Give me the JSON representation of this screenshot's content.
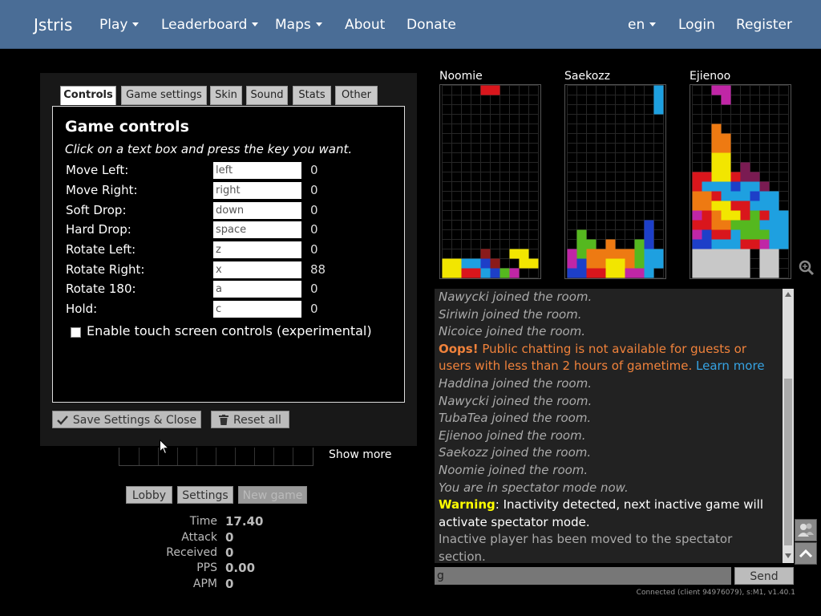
{
  "navbar": {
    "brand": "Jstris",
    "menu": [
      {
        "label": "Play",
        "dropdown": true
      },
      {
        "label": "Leaderboard",
        "dropdown": true
      },
      {
        "label": "Maps",
        "dropdown": true
      },
      {
        "label": "About",
        "dropdown": false
      },
      {
        "label": "Donate",
        "dropdown": false
      }
    ],
    "right": [
      {
        "label": "en",
        "dropdown": true
      },
      {
        "label": "Login",
        "dropdown": false
      },
      {
        "label": "Register",
        "dropdown": false
      }
    ],
    "color": "#4a6d96"
  },
  "settings": {
    "tabs": [
      "Controls",
      "Game settings",
      "Skin",
      "Sound",
      "Stats",
      "Other"
    ],
    "active_tab": "Controls",
    "title": "Game controls",
    "hint": "Click on a text box and press the key you want.",
    "controls": [
      {
        "label": "Move Left:",
        "key": "left",
        "value": "0"
      },
      {
        "label": "Move Right:",
        "key": "right",
        "value": "0"
      },
      {
        "label": "Soft Drop:",
        "key": "down",
        "value": "0"
      },
      {
        "label": "Hard Drop:",
        "key": "space",
        "value": "0"
      },
      {
        "label": "Rotate Left:",
        "key": "z",
        "value": "0"
      },
      {
        "label": "Rotate Right:",
        "key": "x",
        "value": "88"
      },
      {
        "label": "Rotate 180:",
        "key": "a",
        "value": "0"
      },
      {
        "label": "Hold:",
        "key": "c",
        "value": "0"
      }
    ],
    "touch_label": "Enable touch screen controls (experimental)",
    "touch_checked": false,
    "save_label": "Save Settings & Close",
    "reset_label": "Reset all"
  },
  "game": {
    "show_more": "Show more",
    "buttons": [
      "Lobby",
      "Settings",
      "New game"
    ],
    "stats": [
      {
        "label": "Time",
        "value": "17.40"
      },
      {
        "label": "Attack",
        "value": "0"
      },
      {
        "label": "Received",
        "value": "0"
      },
      {
        "label": "PPS",
        "value": "0.00"
      },
      {
        "label": "APM",
        "value": "0"
      }
    ]
  },
  "players": [
    {
      "name": "Noomie"
    },
    {
      "name": "Saekozz"
    },
    {
      "name": "Ejienoo"
    }
  ],
  "chat": {
    "lines": [
      {
        "type": "sys",
        "text": "Nawycki joined the room."
      },
      {
        "type": "sys",
        "text": "Siriwin joined the room."
      },
      {
        "type": "sys",
        "text": "Nicoice joined the room."
      },
      {
        "type": "oops",
        "bold": "Oops!",
        "text": " Public chatting is not available for guests or users with less than 2 hours of gametime.",
        "link": "Learn more"
      },
      {
        "type": "sys",
        "text": "Haddina joined the room."
      },
      {
        "type": "sys",
        "text": "Nawycki joined the room."
      },
      {
        "type": "sys",
        "text": "TubaTea joined the room."
      },
      {
        "type": "sys",
        "text": "Ejienoo joined the room."
      },
      {
        "type": "sys",
        "text": "Saekozz joined the room."
      },
      {
        "type": "sys",
        "text": "Noomie joined the room."
      },
      {
        "type": "sys",
        "text": "You are in spectator mode now."
      },
      {
        "type": "warn",
        "bold": "Warning",
        "text": ": Inactivity detected, next inactive game will activate spectator mode."
      },
      {
        "type": "plain",
        "text": "Inactive player has been moved to the spectator section."
      }
    ],
    "input_value": "g",
    "send_label": "Send",
    "status": "Connected (client 94976079), s:M1, v1.40.1"
  }
}
